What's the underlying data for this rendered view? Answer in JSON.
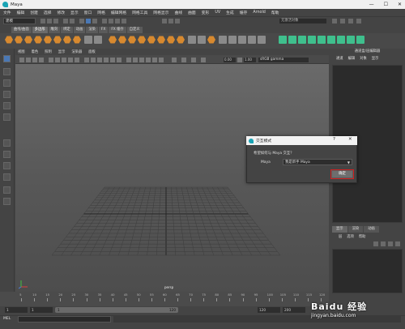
{
  "window": {
    "title": "Maya",
    "minimize": "—",
    "maximize": "☐",
    "close": "✕"
  },
  "menubar": [
    "文件",
    "编辑",
    "创建",
    "选择",
    "修改",
    "显示",
    "窗口",
    "网格",
    "编辑网格",
    "网格工具",
    "网格显示",
    "曲线",
    "曲面",
    "变形",
    "UV",
    "生成",
    "缓存",
    "Arnold",
    "帮助"
  ],
  "statusline": {
    "mode": "建模",
    "shading_field": "无激活对象"
  },
  "shelf_tabs": [
    {
      "label": "曲线/曲面",
      "active": false
    },
    {
      "label": "多边形",
      "active": true
    },
    {
      "label": "雕刻",
      "active": false
    },
    {
      "label": "绑定",
      "active": false
    },
    {
      "label": "动画",
      "active": false
    },
    {
      "label": "渲染",
      "active": false
    },
    {
      "label": "FX",
      "active": false
    },
    {
      "label": "FX 缓存",
      "active": false
    },
    {
      "label": "自定义",
      "active": false
    }
  ],
  "viewport": {
    "menu": [
      "视图",
      "着色",
      "照明",
      "显示",
      "渲染器",
      "面板"
    ],
    "exposure": "0.00",
    "gamma": "1.00",
    "color_space": "sRGB gamma",
    "camera_label": "persp"
  },
  "right_panel": {
    "header": "通道盒/层编辑器",
    "menu": [
      "通道",
      "编辑",
      "对象",
      "显示"
    ],
    "tabs": [
      {
        "label": "显示",
        "active": true
      },
      {
        "label": "渲染",
        "active": false
      },
      {
        "label": "动画",
        "active": false
      }
    ],
    "sub_menu": [
      "层",
      "选项",
      "帮助"
    ]
  },
  "timeline": {
    "ticks": [
      "5",
      "10",
      "15",
      "20",
      "25",
      "30",
      "35",
      "40",
      "45",
      "50",
      "55",
      "60",
      "65",
      "70",
      "75",
      "80",
      "85",
      "90",
      "95",
      "100",
      "105",
      "110",
      "115",
      "120"
    ],
    "start": "1",
    "current": "1",
    "range_start": "1",
    "range_end": "120",
    "end": "120",
    "anim_end": "200"
  },
  "cmdline": {
    "label": "MEL"
  },
  "dialog": {
    "title": "交互模式",
    "help": "?",
    "close": "✕",
    "prompt": "希望如何与 Maya 交互？",
    "field_label": "Maya",
    "selected_option": "我是新手 Maya",
    "ok_label": "确定"
  },
  "watermark": {
    "brand": "Baidu 经验",
    "url": "jingyan.baidu.com"
  },
  "colors": {
    "accent_highlight": "#d02020",
    "maya_teal": "#1aa4b5"
  }
}
